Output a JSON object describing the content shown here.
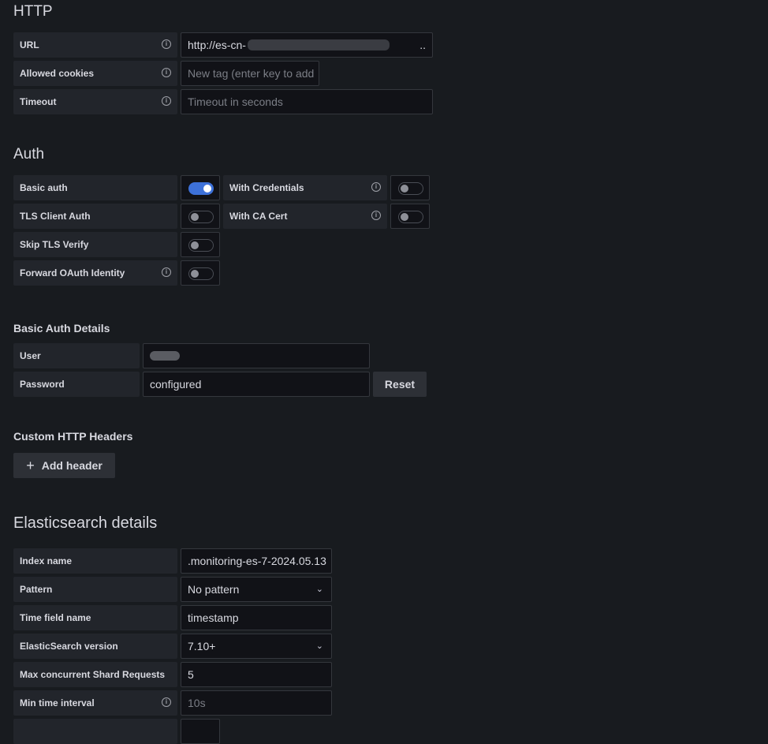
{
  "http": {
    "title": "HTTP",
    "url": {
      "label": "URL",
      "value": "http://es-cn-",
      "ellipsis": ".."
    },
    "cookies": {
      "label": "Allowed cookies",
      "placeholder": "New tag (enter key to add"
    },
    "timeout": {
      "label": "Timeout",
      "placeholder": "Timeout in seconds"
    }
  },
  "auth": {
    "title": "Auth",
    "basic_auth": {
      "label": "Basic auth",
      "on": true
    },
    "with_credentials": {
      "label": "With Credentials",
      "on": false
    },
    "tls_client": {
      "label": "TLS Client Auth",
      "on": false
    },
    "with_ca": {
      "label": "With CA Cert",
      "on": false
    },
    "skip_tls": {
      "label": "Skip TLS Verify",
      "on": false
    },
    "oauth": {
      "label": "Forward OAuth Identity",
      "on": false
    }
  },
  "basic_details": {
    "title": "Basic Auth Details",
    "user_label": "User",
    "password_label": "Password",
    "password_value": "configured",
    "reset": "Reset"
  },
  "headers": {
    "title": "Custom HTTP Headers",
    "add": "Add header",
    "add_icon": "+"
  },
  "es": {
    "title": "Elasticsearch details",
    "index": {
      "label": "Index name",
      "value": ".monitoring-es-7-2024.05.13"
    },
    "pattern": {
      "label": "Pattern",
      "value": "No pattern"
    },
    "time_field": {
      "label": "Time field name",
      "value": "timestamp"
    },
    "version": {
      "label": "ElasticSearch version",
      "value": "7.10+"
    },
    "shards": {
      "label": "Max concurrent Shard Requests",
      "value": "5"
    },
    "min_interval": {
      "label": "Min time interval",
      "placeholder": "10s"
    }
  },
  "icons": {
    "info": "i",
    "chevron": "⌄"
  },
  "colors": {
    "accent": "#3d71d9",
    "background": "#181b1f"
  }
}
